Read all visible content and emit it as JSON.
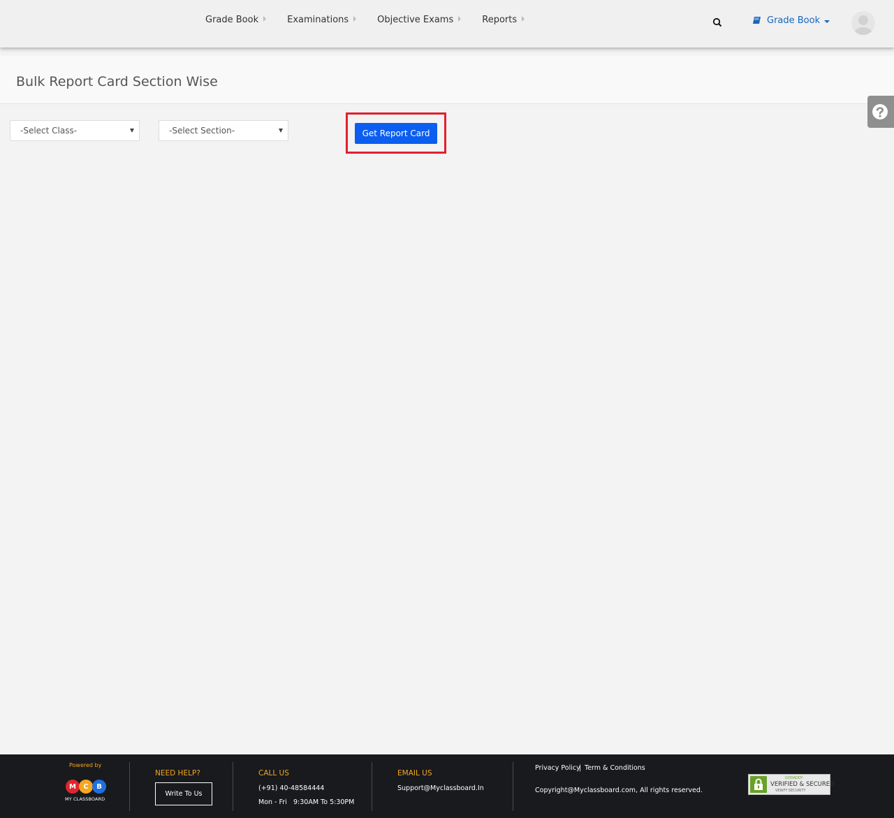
{
  "nav": {
    "items": [
      {
        "label": "Grade Book"
      },
      {
        "label": "Examinations"
      },
      {
        "label": "Objective Exams"
      },
      {
        "label": "Reports"
      }
    ],
    "module_label": "Grade Book"
  },
  "page": {
    "title": "Bulk Report Card Section Wise"
  },
  "filters": {
    "class_select": "-Select Class-",
    "section_select": "-Select Section-",
    "submit_label": "Get Report Card"
  },
  "footer": {
    "powered_by": "Powered by",
    "logo_letters": [
      "M",
      "C",
      "B"
    ],
    "logo_text": "MY CLASSBOARD",
    "help_heading": "NEED HELP?",
    "write_label": "Write To Us",
    "call_heading": "CALL US",
    "phone": "(+91) 40-48584444",
    "hours_days": "Mon - Fri",
    "hours_time": "9:30AM To 5:30PM",
    "email_heading": "EMAIL US",
    "email": "Support@Myclassboard.In",
    "privacy": "Privacy Policy",
    "separator": "|",
    "terms": "Term & Conditions",
    "copyright": "Copyright@Myclassboard.com, All rights reserved.",
    "badge_top": "GODADDY",
    "badge_main": "VERIFIED & SECURED",
    "badge_sub": "VERIFY SECURITY"
  },
  "colors": {
    "accent": "#0b5ef0",
    "highlight": "#e2202c",
    "footer_heading": "#f5a623",
    "logo_m": "#e0262c",
    "logo_c": "#f5a623",
    "logo_b": "#1f6fe0"
  }
}
